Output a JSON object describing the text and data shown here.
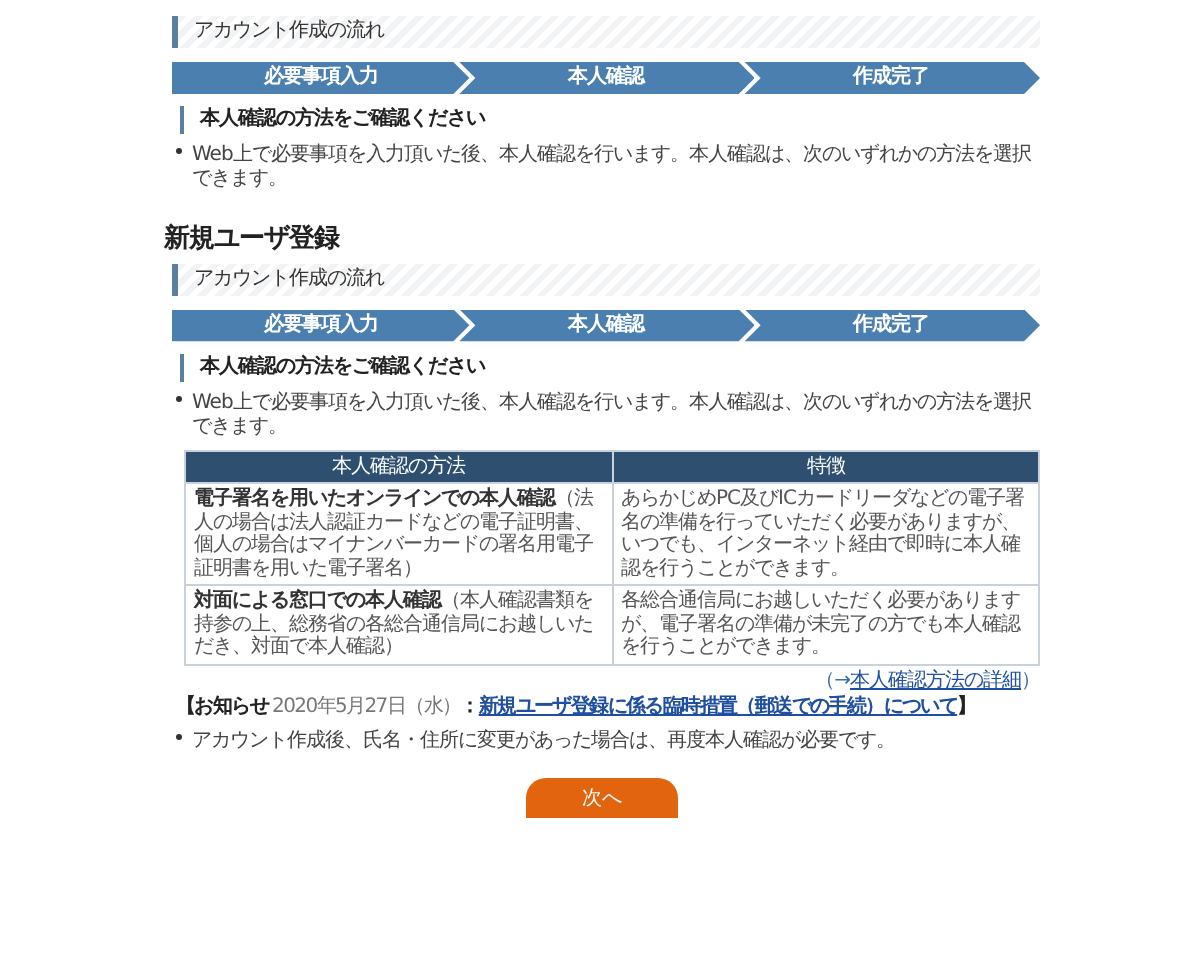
{
  "sections": [
    {
      "flow_heading": "アカウント作成の流れ",
      "steps": [
        {
          "label": "必要事項入力"
        },
        {
          "label": "本人確認"
        },
        {
          "label": "作成完了"
        }
      ],
      "method_heading": "本人確認の方法をご確認ください",
      "bullets": [
        "Web上で必要事項を入力頂いた後、本人確認を行います。本人確認は、次のいずれかの方法を選択できます。"
      ]
    },
    {
      "title": "新規ユーザ登録",
      "flow_heading": "アカウント作成の流れ",
      "steps": [
        {
          "label": "必要事項入力"
        },
        {
          "label": "本人確認"
        },
        {
          "label": "作成完了"
        }
      ],
      "method_heading": "本人確認の方法をご確認ください",
      "bullets": [
        "Web上で必要事項を入力頂いた後、本人確認を行います。本人確認は、次のいずれかの方法を選択できます。"
      ],
      "table": {
        "columns": [
          "本人確認の方法",
          "特徴"
        ],
        "rows": [
          [
            "**電子署名を用いたオンラインでの本人確認**（法人の場合は法人認証カードなどの電子証明書、個人の場合はマイナンバーカードの署名用電子証明書を用いた電子署名）",
            "あらかじめPC及びICカードリーダなどの電子署名の準備を行っていただく必要がありますが、いつでも、インターネット経由で即時に本人確認を行うことができます。"
          ],
          [
            "**対面による窓口での本人確認**（本人確認書類を持参の上、総務省の各総合通信局にお越しいただき、対面で本人確認）",
            "各総合通信局にお越しいただく必要がありますが、電子署名の準備が未完了の方でも本人確認を行うことができます。"
          ]
        ]
      },
      "details_link": {
        "open": "（→",
        "link": "本人確認方法の詳細",
        "close": "）"
      },
      "notice": {
        "label": "【お知らせ",
        "date": "2020年5月27日（水）",
        "separator": "：",
        "link": "新規ユーザ登録に係る臨時措置（郵送での手続）について",
        "close": "】"
      },
      "after_bullets": [
        "アカウント作成後、氏名・住所に変更があった場合は、再度本人確認が必要です。"
      ],
      "button": "次へ"
    }
  ]
}
